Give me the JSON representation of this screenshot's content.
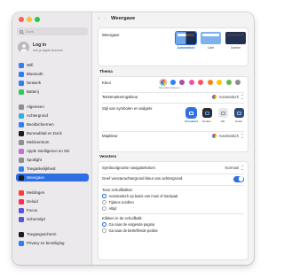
{
  "colors": {
    "accent": "#2f6fe4",
    "traffic_close": "#ff5f57",
    "traffic_min": "#febc2e",
    "traffic_max": "#28c840"
  },
  "sidebar": {
    "search_placeholder": "Zoek",
    "login": {
      "title": "Log in",
      "subtitle": "met je Apple Account"
    },
    "items": [
      {
        "label": "Wifi",
        "icon": "wifi-icon",
        "color": "#2f7ff6"
      },
      {
        "label": "Bluetooth",
        "icon": "bluetooth-icon",
        "color": "#2f7ff6"
      },
      {
        "label": "Netwerk",
        "icon": "globe-icon",
        "color": "#2f7ff6"
      },
      {
        "label": "Batterij",
        "icon": "battery-icon",
        "color": "#34c759"
      },
      {
        "label": "Algemeen",
        "icon": "gear-icon",
        "color": "#8e8e93"
      },
      {
        "label": "Achtergrond",
        "icon": "wallpaper-icon",
        "color": "#32ade6"
      },
      {
        "label": "Beeldschermen",
        "icon": "display-icon",
        "color": "#2f7ff6"
      },
      {
        "label": "Bureaublad en Dock",
        "icon": "dock-icon",
        "color": "#1d1d1f"
      },
      {
        "label": "Meldcentrum",
        "icon": "control-centre-icon",
        "color": "#8e8e93"
      },
      {
        "label": "Apple Intelligence en Siri",
        "icon": "siri-icon",
        "color": "#c86dd7"
      },
      {
        "label": "Spotlight",
        "icon": "spotlight-icon",
        "color": "#8e8e93"
      },
      {
        "label": "Toegankelijkheid",
        "icon": "accessibility-icon",
        "color": "#2f7ff6"
      },
      {
        "label": "Weergave",
        "icon": "appearance-icon",
        "color": "#1d1d1f",
        "active": true
      },
      {
        "label": "Meldingen",
        "icon": "notifications-icon",
        "color": "#ff3b30"
      },
      {
        "label": "Geluid",
        "icon": "sound-icon",
        "color": "#ff2d55"
      },
      {
        "label": "Focus",
        "icon": "focus-icon",
        "color": "#5856d6"
      },
      {
        "label": "Schermtijd",
        "icon": "screen-time-icon",
        "color": "#5856d6"
      },
      {
        "label": "Toegangsscherm",
        "icon": "lock-screen-icon",
        "color": "#1d1d1f"
      },
      {
        "label": "Privacy en beveiliging",
        "icon": "hand-icon",
        "color": "#2f7ff6"
      }
    ]
  },
  "content": {
    "title": "Weergave",
    "back_icon": "chevron-left-icon",
    "forward_icon": "chevron-right-icon",
    "appearance": {
      "label": "Weergave",
      "options": [
        {
          "label": "Automatisch",
          "selected": true
        },
        {
          "label": "Licht",
          "selected": false
        },
        {
          "label": "Donker",
          "selected": false
        }
      ]
    },
    "theme": {
      "heading": "Thema",
      "accent_label": "Kleur",
      "accent_caption": "Meerdere kleuren",
      "accent_colors": [
        "#c7c7cc",
        "#2f7ff6",
        "#a550a7",
        "#f74f9e",
        "#ff5257",
        "#f7821b",
        "#ffc600",
        "#62ba46",
        "#8c8c8c"
      ],
      "highlight_label": "Tekstmarkeringskleur",
      "highlight_value": "Automatisch",
      "icon_style_label": "Stijl van symbolen en widgets",
      "icon_styles": [
        {
          "label": "Standaard",
          "selected": true
        },
        {
          "label": "Donker",
          "selected": false
        },
        {
          "label": "Wit",
          "selected": false
        },
        {
          "label": "Getint",
          "selected": false
        }
      ],
      "folder_label": "Mapkleur",
      "folder_value": "Automatisch"
    },
    "windows": {
      "heading": "Vensters",
      "sidebar_icon_label": "Symboolgrootte navigatiekolom",
      "sidebar_icon_value": "Normaal",
      "tint_label": "Geef vensterachtergrond kleur van achtergrond",
      "tint_on": true,
      "scrollbars_label": "Toon schuifbalken",
      "scrollbar_options": [
        {
          "label": "Automatisch op basis van muis of trackpad",
          "selected": true
        },
        {
          "label": "Tijdens scrollen",
          "selected": false
        },
        {
          "label": "Altijd",
          "selected": false
        }
      ],
      "click_label": "Klikken in de schuifbalk",
      "click_options": [
        {
          "label": "Ga naar de volgende pagina",
          "selected": true
        },
        {
          "label": "Ga naar de betreffende positie",
          "selected": false
        }
      ]
    }
  }
}
